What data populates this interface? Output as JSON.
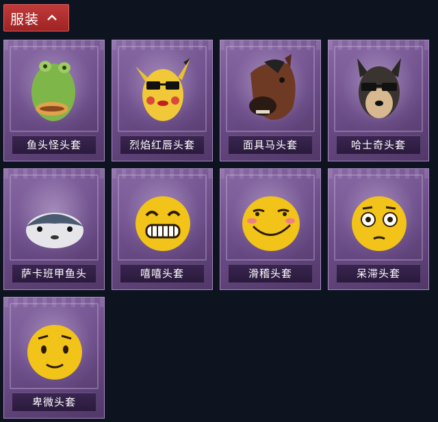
{
  "category_tab": {
    "label": "服装"
  },
  "items": [
    {
      "name": "鱼头怪头套"
    },
    {
      "name": "烈焰红唇头套"
    },
    {
      "name": "面具马头套"
    },
    {
      "name": "哈士奇头套"
    },
    {
      "name": "萨卡班甲鱼头"
    },
    {
      "name": "嘻嘻头套"
    },
    {
      "name": "滑稽头套"
    },
    {
      "name": "呆滞头套"
    },
    {
      "name": "卑微头套"
    }
  ]
}
